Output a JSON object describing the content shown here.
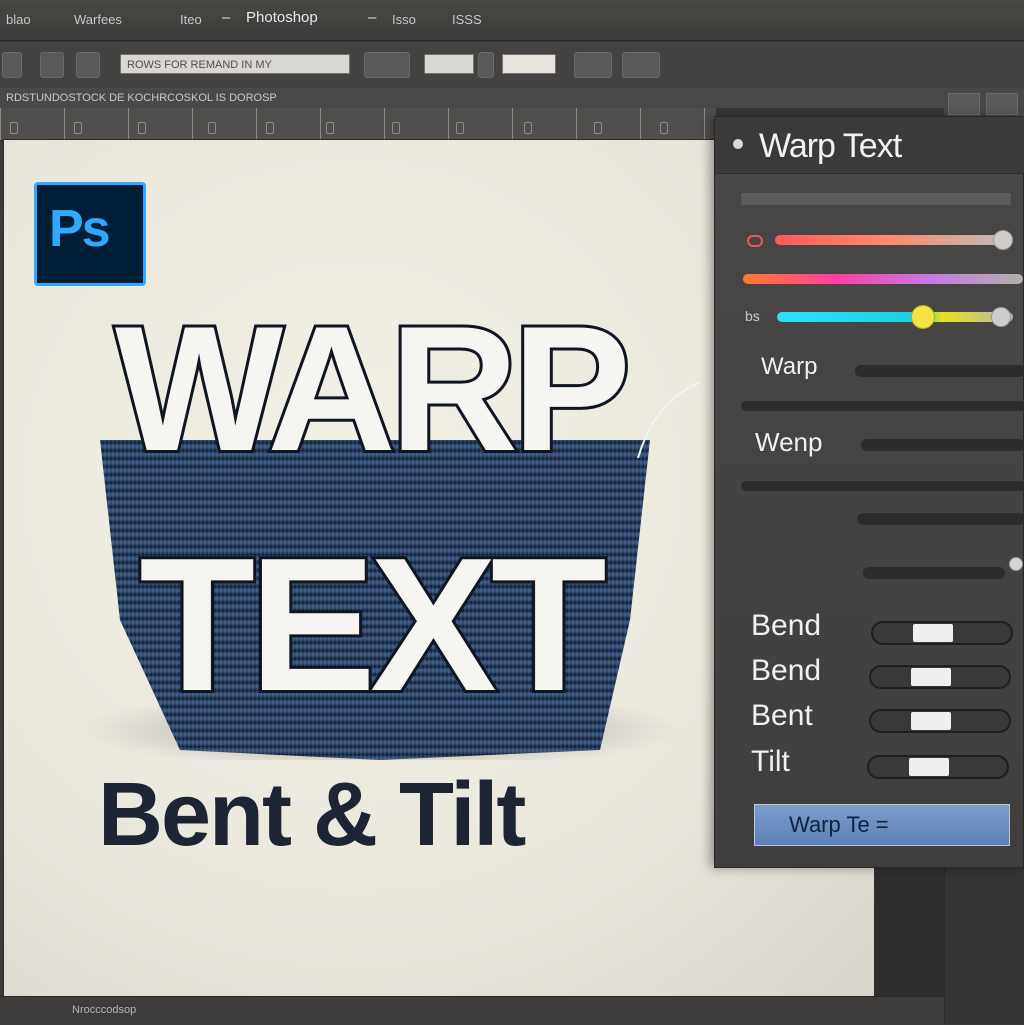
{
  "titlebar": {
    "item1": "blao",
    "item2": "Warfees",
    "item3": "Iteo",
    "sep1": "–",
    "app_title": "Photoshop",
    "sep2": "–",
    "item4": "Isso",
    "item5": "ISSS"
  },
  "options": {
    "field1": "ROWS FOR REMAND IN MY",
    "field2": "",
    "field3": ""
  },
  "doc_tab": "RDSTUNDOSTOCK DE KOCHRCOSKOL IS DOROSP",
  "canvas": {
    "logo_text": "Ps",
    "headline_line1": "WARP",
    "headline_line2": "TEXT",
    "subtitle": "Bent & Tilt",
    "footer_text": "Nrocccodsop"
  },
  "panel": {
    "title": "Warp Text",
    "slider3_label": "bs",
    "row_warp1": "Warp",
    "row_warp2": "Wenp",
    "bend1": "Bend",
    "bend2": "Bend",
    "bent": "Bent",
    "tilt": "Tilt",
    "button_label": "Warp   Te ="
  },
  "colors": {
    "ps_blue": "#31a8ff",
    "ps_dark": "#001e36",
    "button_blue": "#6b8fc2",
    "knob_yellow": "#f2e441"
  }
}
